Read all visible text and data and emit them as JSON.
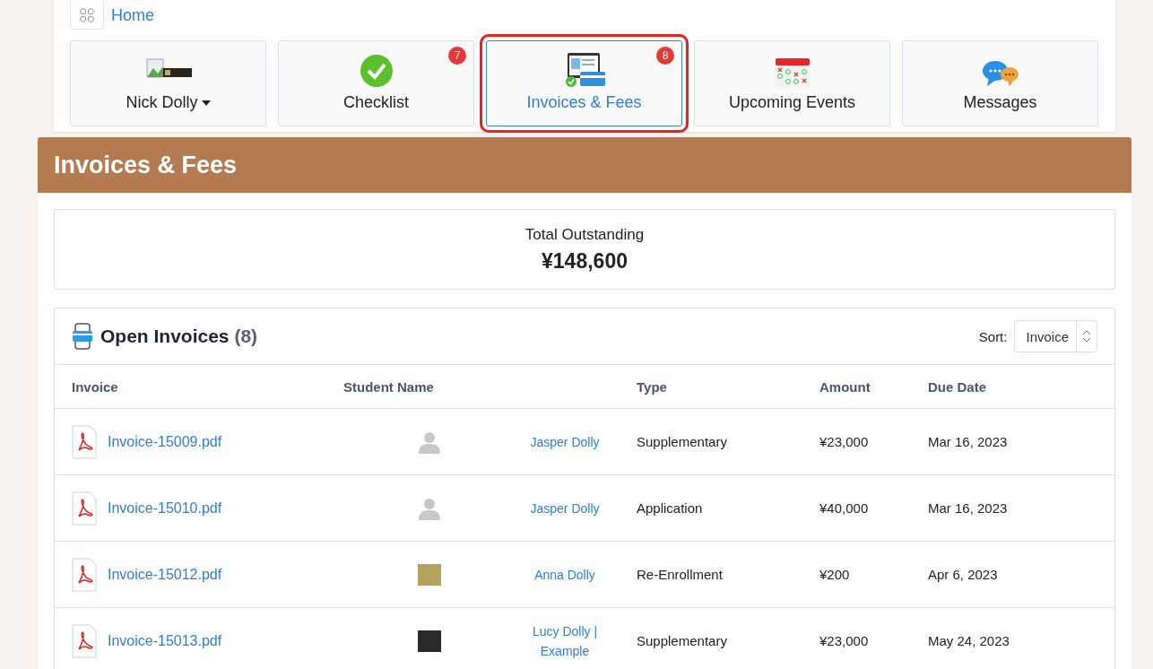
{
  "breadcrumb": {
    "label": "Home"
  },
  "tiles": [
    {
      "kind": "profile",
      "label": "Nick Dolly",
      "selected": false
    },
    {
      "kind": "checklist",
      "label": "Checklist",
      "badge": "7",
      "selected": false
    },
    {
      "kind": "invoices",
      "label": "Invoices & Fees",
      "badge": "8",
      "selected": true
    },
    {
      "kind": "calendar",
      "label": "Upcoming Events",
      "selected": false
    },
    {
      "kind": "messages",
      "label": "Messages",
      "selected": false
    }
  ],
  "section_title": "Invoices & Fees",
  "total": {
    "label": "Total Outstanding",
    "amount": "¥148,600"
  },
  "open_invoices": {
    "title": "Open Invoices",
    "count": "(8)",
    "sort_label": "Sort:",
    "sort_value": "Invoice",
    "columns": [
      "Invoice",
      "Student Name",
      "Type",
      "Amount",
      "Due Date"
    ],
    "rows": [
      {
        "file": "Invoice-15009.pdf",
        "avatar": {
          "kind": "silhouette"
        },
        "student": "Jasper Dolly",
        "type": "Supplementary",
        "amount": "¥23,000",
        "due": "Mar 16, 2023"
      },
      {
        "file": "Invoice-15010.pdf",
        "avatar": {
          "kind": "silhouette"
        },
        "student": "Jasper Dolly",
        "type": "Application",
        "amount": "¥40,000",
        "due": "Mar 16, 2023"
      },
      {
        "file": "Invoice-15012.pdf",
        "avatar": {
          "kind": "photo"
        },
        "student": "Anna Dolly",
        "type": "Re-Enrollment",
        "amount": "¥200",
        "due": "Apr 6, 2023"
      },
      {
        "file": "Invoice-15013.pdf",
        "avatar": {
          "kind": "dark"
        },
        "student": "Lucy Dolly | Example",
        "type": "Supplementary",
        "amount": "¥23,000",
        "due": "May 24, 2023"
      }
    ]
  }
}
